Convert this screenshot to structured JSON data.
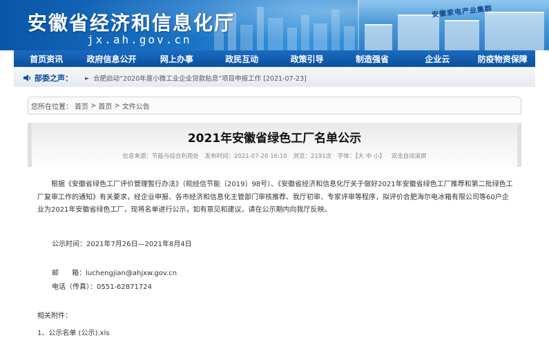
{
  "header": {
    "site_title": "安徽省经济和信息化厅",
    "site_domain": "jx.ah.gov.cn",
    "banner_photo_text": "安徽家电产业集群"
  },
  "nav": {
    "items": [
      {
        "label": "首页资讯"
      },
      {
        "label": "政府信息公开"
      },
      {
        "label": "网上办事"
      },
      {
        "label": "政民互动"
      },
      {
        "label": "政策引导"
      },
      {
        "label": "制造强省"
      },
      {
        "label": "企业云"
      },
      {
        "label": "防疫物资保障"
      }
    ]
  },
  "notice": {
    "label": "部委之声：",
    "arrow": "►",
    "text": "合肥启动“2020年度小微工业企业贷款贴息”项目申报工作 [2021-07-23]"
  },
  "breadcrumb": {
    "prefix": "您所在位置：",
    "items": [
      "首页",
      "首页",
      "文件公告"
    ],
    "separator": ">"
  },
  "article": {
    "title": "2021年安徽省绿色工厂名单公示",
    "meta": {
      "source": "信息来源：节能与综合利用处",
      "published": "发布时间：2021-07-26 16:10",
      "views": "浏览：2191次",
      "font": "字体：【大 中 小】",
      "autoscroll": "双击自动滚屏"
    },
    "body": "根据《安徽省绿色工厂评价管理暂行办法》（皖经信节能〔2019〕98号）、《安徽省经济和信息化厅关于做好2021年安徽省绿色工厂推荐和第二批绿色工厂复审工作的通知》有关要求，经企业申报、各市经济和信息化主管部门审核推荐、我厅初审、专家评审等程序，拟评价合肥海尔电冰箱有限公司等60户企业为2021年安徽省绿色工厂，现将名单进行公示，如有意见和建议，请在公示期内向我厅反映。",
    "period": "公示时间：2021年7月26日—2021年8月4日",
    "email": "邮      箱：luchengjian@ahjxw.gov.cn",
    "phone": "电话（传真）：0551-62871724",
    "attachments_label": "相关附件：",
    "attachment_1": "1、公示名单 (公示).xls"
  },
  "colors": {
    "nav_bg": "#0b4f9e",
    "brand_blue": "#1a74c6",
    "notice_label": "#0b4f9e"
  }
}
